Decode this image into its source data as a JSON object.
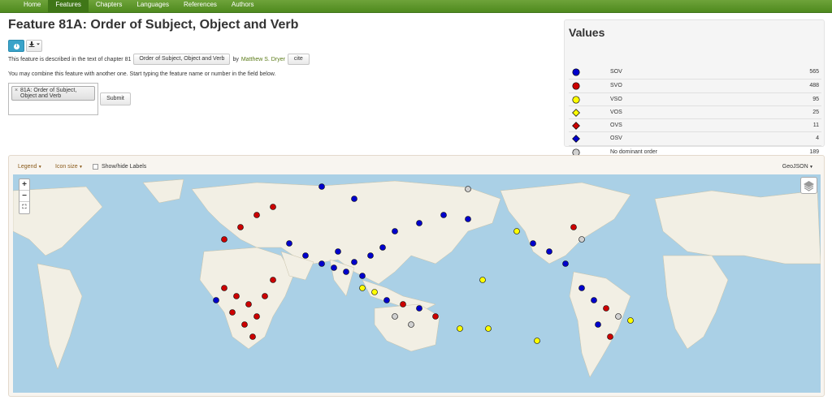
{
  "nav": {
    "items": [
      {
        "label": "Home"
      },
      {
        "label": "Features"
      },
      {
        "label": "Chapters"
      },
      {
        "label": "Languages"
      },
      {
        "label": "References"
      },
      {
        "label": "Authors"
      }
    ],
    "active": "Features"
  },
  "page": {
    "title": "Feature 81A: Order of Subject, Object and Verb",
    "desc_prefix": "This feature is described in the text of chapter 81",
    "chapter_button": "Order of Subject, Object and Verb",
    "by": "by",
    "author": "Matthew S. Dryer",
    "cite_button": "cite",
    "combine_text": "You may combine this feature with another one. Start typing the feature name or number in the field below.",
    "combine_tag": "81A: Order of Subject, Object and Verb",
    "combine_tag_remove": "×",
    "submit_button": "Submit",
    "info_icon": "i"
  },
  "values": {
    "title": "Values",
    "items": [
      {
        "name": "SOV",
        "count": "565",
        "shape": "circle",
        "color": "#0000cc"
      },
      {
        "name": "SVO",
        "count": "488",
        "shape": "circle",
        "color": "#cc0000"
      },
      {
        "name": "VSO",
        "count": "95",
        "shape": "circle",
        "color": "#ffff00"
      },
      {
        "name": "VOS",
        "count": "25",
        "shape": "diamond",
        "color": "#ffff00"
      },
      {
        "name": "OVS",
        "count": "11",
        "shape": "diamond",
        "color": "#cc0000"
      },
      {
        "name": "OSV",
        "count": "4",
        "shape": "diamond",
        "color": "#0000cc"
      },
      {
        "name": "No dominant order",
        "count": "189",
        "shape": "circle",
        "color": "#d0d0d0"
      }
    ]
  },
  "map": {
    "legend_label": "Legend",
    "icon_size_label": "Icon size",
    "labels_toggle": "Show/hide Labels",
    "geojson_label": "GeoJSON",
    "zoom_in": "+",
    "zoom_out": "−",
    "fullscreen_icon": "fullscreen-icon",
    "layers_icon": "layers-icon",
    "ocean_color": "#aad0e6",
    "land_color": "#f2efe4"
  }
}
